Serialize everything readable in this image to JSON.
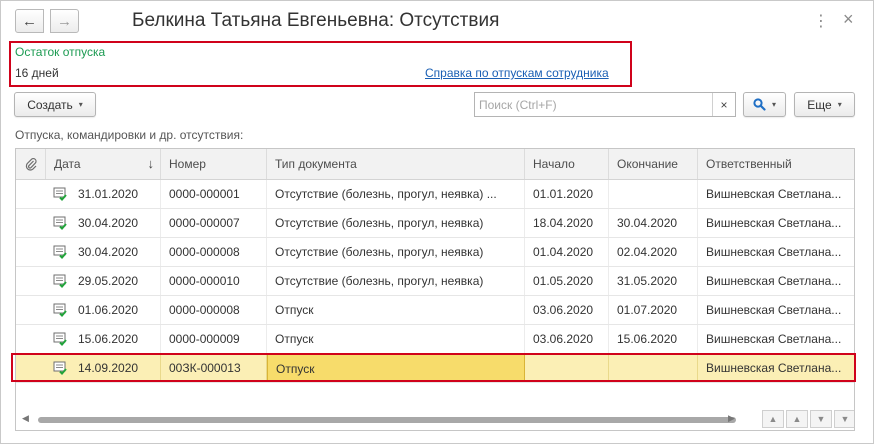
{
  "window": {
    "title": "Белкина Татьяна Евгеньевна: Отсутствия",
    "back_icon": "←",
    "forward_icon": "→",
    "more_icon": "⋮",
    "close_icon": "×"
  },
  "vacation": {
    "label": "Остаток отпуска",
    "value": "16 дней",
    "link": "Справка по отпускам сотрудника"
  },
  "toolbar": {
    "create_label": "Создать",
    "search_placeholder": "Поиск (Ctrl+F)",
    "clear_icon": "×",
    "search_icon": "search-icon",
    "more_label": "Еще",
    "caret": "▾"
  },
  "list": {
    "caption": "Отпуска, командировки и др. отсутствия:",
    "columns": {
      "date": "Дата",
      "number": "Номер",
      "doc_type": "Тип документа",
      "start": "Начало",
      "end": "Окончание",
      "responsible": "Ответственный"
    },
    "sort_arrow": "↓",
    "rows": [
      {
        "date": "31.01.2020",
        "number": "0000-000001",
        "doc_type": "Отсутствие (болезнь, прогул, неявка) ...",
        "start": "01.01.2020",
        "end": "",
        "responsible": "Вишневская Светлана..."
      },
      {
        "date": "30.04.2020",
        "number": "0000-000007",
        "doc_type": "Отсутствие (болезнь, прогул, неявка)",
        "start": "18.04.2020",
        "end": "30.04.2020",
        "responsible": "Вишневская Светлана..."
      },
      {
        "date": "30.04.2020",
        "number": "0000-000008",
        "doc_type": "Отсутствие (болезнь, прогул, неявка)",
        "start": "01.04.2020",
        "end": "02.04.2020",
        "responsible": "Вишневская Светлана..."
      },
      {
        "date": "29.05.2020",
        "number": "0000-000010",
        "doc_type": "Отсутствие (болезнь, прогул, неявка)",
        "start": "01.05.2020",
        "end": "31.05.2020",
        "responsible": "Вишневская Светлана..."
      },
      {
        "date": "01.06.2020",
        "number": "0000-000008",
        "doc_type": "Отпуск",
        "start": "03.06.2020",
        "end": "01.07.2020",
        "responsible": "Вишневская Светлана..."
      },
      {
        "date": "15.06.2020",
        "number": "0000-000009",
        "doc_type": "Отпуск",
        "start": "03.06.2020",
        "end": "15.06.2020",
        "responsible": "Вишневская Светлана..."
      },
      {
        "date": "14.09.2020",
        "number": "00ЗК-000013",
        "doc_type": "Отпуск",
        "start": "",
        "end": "",
        "responsible": "Вишневская Светлана..."
      }
    ],
    "selected_row": 6
  },
  "colors": {
    "highlight": "#d0021b",
    "vacation_label": "#1c9b52",
    "link": "#1a5fb4",
    "selected_row": "#fbefb5",
    "current_cell": "#f7dc6b"
  }
}
